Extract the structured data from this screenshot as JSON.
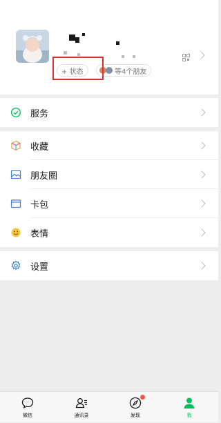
{
  "profile": {
    "status_label": "+ 状态",
    "friends_label": "等4个朋友"
  },
  "menu": {
    "services": "服务",
    "favorites": "收藏",
    "moments": "朋友圈",
    "cards": "卡包",
    "stickers": "表情",
    "settings": "设置"
  },
  "tabs": [
    {
      "label": "微信",
      "icon": "chat-bubble-icon"
    },
    {
      "label": "通讯录",
      "icon": "contacts-icon"
    },
    {
      "label": "发现",
      "icon": "compass-icon",
      "badge": true
    },
    {
      "label": "我",
      "icon": "person-icon",
      "active": true
    }
  ],
  "colors": {
    "accent": "#07c160",
    "highlight_box": "#d9342b",
    "badge": "#fa5151"
  }
}
